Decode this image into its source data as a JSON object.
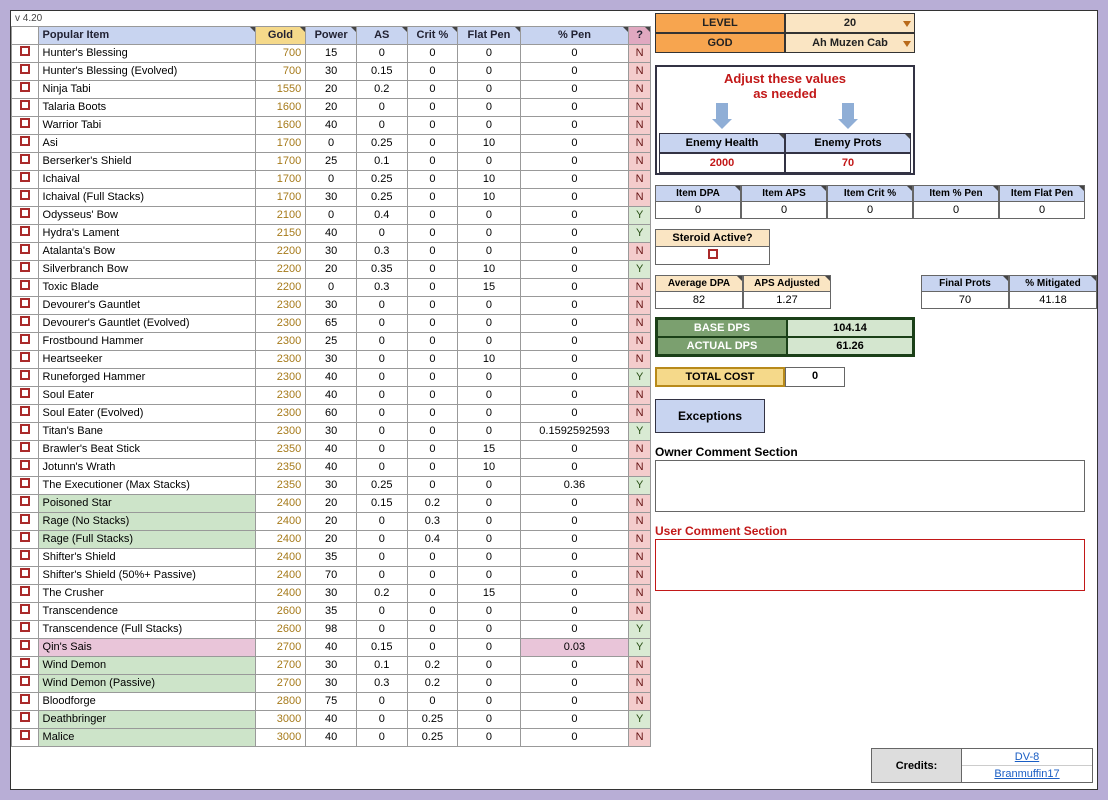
{
  "version": "v 4.20",
  "headers": {
    "checkbox": "",
    "item": "Popular Item",
    "gold": "Gold",
    "power": "Power",
    "as": "AS",
    "crit": "Crit %",
    "flatpen": "Flat Pen",
    "pctpen": "% Pen",
    "q": "?"
  },
  "items": [
    {
      "name": "Hunter's Blessing",
      "gold": 700,
      "pw": 15,
      "as": 0,
      "cr": 0,
      "fp": 0,
      "pp": "0",
      "yn": "N",
      "cls": ""
    },
    {
      "name": "Hunter's Blessing (Evolved)",
      "gold": 700,
      "pw": 30,
      "as": 0.15,
      "cr": 0,
      "fp": 0,
      "pp": "0",
      "yn": "N",
      "cls": ""
    },
    {
      "name": "Ninja Tabi",
      "gold": 1550,
      "pw": 20,
      "as": 0.2,
      "cr": 0,
      "fp": 0,
      "pp": "0",
      "yn": "N",
      "cls": ""
    },
    {
      "name": "Talaria Boots",
      "gold": 1600,
      "pw": 20,
      "as": 0,
      "cr": 0,
      "fp": 0,
      "pp": "0",
      "yn": "N",
      "cls": ""
    },
    {
      "name": "Warrior Tabi",
      "gold": 1600,
      "pw": 40,
      "as": 0,
      "cr": 0,
      "fp": 0,
      "pp": "0",
      "yn": "N",
      "cls": ""
    },
    {
      "name": "Asi",
      "gold": 1700,
      "pw": 0,
      "as": 0.25,
      "cr": 0,
      "fp": 10,
      "pp": "0",
      "yn": "N",
      "cls": ""
    },
    {
      "name": "Berserker's Shield",
      "gold": 1700,
      "pw": 25,
      "as": 0.1,
      "cr": 0,
      "fp": 0,
      "pp": "0",
      "yn": "N",
      "cls": ""
    },
    {
      "name": "Ichaival",
      "gold": 1700,
      "pw": 0,
      "as": 0.25,
      "cr": 0,
      "fp": 10,
      "pp": "0",
      "yn": "N",
      "cls": ""
    },
    {
      "name": "Ichaival (Full Stacks)",
      "gold": 1700,
      "pw": 30,
      "as": 0.25,
      "cr": 0,
      "fp": 10,
      "pp": "0",
      "yn": "N",
      "cls": ""
    },
    {
      "name": "Odysseus' Bow",
      "gold": 2100,
      "pw": 0,
      "as": 0.4,
      "cr": 0,
      "fp": 0,
      "pp": "0",
      "yn": "Y",
      "cls": ""
    },
    {
      "name": "Hydra's Lament",
      "gold": 2150,
      "pw": 40,
      "as": 0,
      "cr": 0,
      "fp": 0,
      "pp": "0",
      "yn": "Y",
      "cls": ""
    },
    {
      "name": "Atalanta's Bow",
      "gold": 2200,
      "pw": 30,
      "as": 0.3,
      "cr": 0,
      "fp": 0,
      "pp": "0",
      "yn": "N",
      "cls": ""
    },
    {
      "name": "Silverbranch Bow",
      "gold": 2200,
      "pw": 20,
      "as": 0.35,
      "cr": 0,
      "fp": 10,
      "pp": "0",
      "yn": "Y",
      "cls": ""
    },
    {
      "name": "Toxic Blade",
      "gold": 2200,
      "pw": 0,
      "as": 0.3,
      "cr": 0,
      "fp": 15,
      "pp": "0",
      "yn": "N",
      "cls": ""
    },
    {
      "name": "Devourer's Gauntlet",
      "gold": 2300,
      "pw": 30,
      "as": 0,
      "cr": 0,
      "fp": 0,
      "pp": "0",
      "yn": "N",
      "cls": ""
    },
    {
      "name": "Devourer's Gauntlet (Evolved)",
      "gold": 2300,
      "pw": 65,
      "as": 0,
      "cr": 0,
      "fp": 0,
      "pp": "0",
      "yn": "N",
      "cls": ""
    },
    {
      "name": "Frostbound Hammer",
      "gold": 2300,
      "pw": 25,
      "as": 0,
      "cr": 0,
      "fp": 0,
      "pp": "0",
      "yn": "N",
      "cls": ""
    },
    {
      "name": "Heartseeker",
      "gold": 2300,
      "pw": 30,
      "as": 0,
      "cr": 0,
      "fp": 10,
      "pp": "0",
      "yn": "N",
      "cls": ""
    },
    {
      "name": "Runeforged Hammer",
      "gold": 2300,
      "pw": 40,
      "as": 0,
      "cr": 0,
      "fp": 0,
      "pp": "0",
      "yn": "Y",
      "cls": ""
    },
    {
      "name": "Soul Eater",
      "gold": 2300,
      "pw": 40,
      "as": 0,
      "cr": 0,
      "fp": 0,
      "pp": "0",
      "yn": "N",
      "cls": ""
    },
    {
      "name": "Soul Eater (Evolved)",
      "gold": 2300,
      "pw": 60,
      "as": 0,
      "cr": 0,
      "fp": 0,
      "pp": "0",
      "yn": "N",
      "cls": ""
    },
    {
      "name": "Titan's Bane",
      "gold": 2300,
      "pw": 30,
      "as": 0,
      "cr": 0,
      "fp": 0,
      "pp": "0.1592592593",
      "yn": "Y",
      "cls": ""
    },
    {
      "name": "Brawler's Beat Stick",
      "gold": 2350,
      "pw": 40,
      "as": 0,
      "cr": 0,
      "fp": 15,
      "pp": "0",
      "yn": "N",
      "cls": ""
    },
    {
      "name": "Jotunn's Wrath",
      "gold": 2350,
      "pw": 40,
      "as": 0,
      "cr": 0,
      "fp": 10,
      "pp": "0",
      "yn": "N",
      "cls": ""
    },
    {
      "name": "The Executioner (Max Stacks)",
      "gold": 2350,
      "pw": 30,
      "as": 0.25,
      "cr": 0,
      "fp": 0,
      "pp": "0.36",
      "yn": "Y",
      "cls": ""
    },
    {
      "name": "Poisoned Star",
      "gold": 2400,
      "pw": 20,
      "as": 0.15,
      "cr": 0.2,
      "fp": 0,
      "pp": "0",
      "yn": "N",
      "cls": "row-green"
    },
    {
      "name": "Rage (No Stacks)",
      "gold": 2400,
      "pw": 20,
      "as": 0,
      "cr": 0.3,
      "fp": 0,
      "pp": "0",
      "yn": "N",
      "cls": "row-green"
    },
    {
      "name": "Rage (Full Stacks)",
      "gold": 2400,
      "pw": 20,
      "as": 0,
      "cr": 0.4,
      "fp": 0,
      "pp": "0",
      "yn": "N",
      "cls": "row-green"
    },
    {
      "name": "Shifter's Shield",
      "gold": 2400,
      "pw": 35,
      "as": 0,
      "cr": 0,
      "fp": 0,
      "pp": "0",
      "yn": "N",
      "cls": ""
    },
    {
      "name": "Shifter's Shield (50%+ Passive)",
      "gold": 2400,
      "pw": 70,
      "as": 0,
      "cr": 0,
      "fp": 0,
      "pp": "0",
      "yn": "N",
      "cls": ""
    },
    {
      "name": "The Crusher",
      "gold": 2400,
      "pw": 30,
      "as": 0.2,
      "cr": 0,
      "fp": 15,
      "pp": "0",
      "yn": "N",
      "cls": ""
    },
    {
      "name": "Transcendence",
      "gold": 2600,
      "pw": 35,
      "as": 0,
      "cr": 0,
      "fp": 0,
      "pp": "0",
      "yn": "N",
      "cls": ""
    },
    {
      "name": "Transcendence (Full Stacks)",
      "gold": 2600,
      "pw": 98,
      "as": 0,
      "cr": 0,
      "fp": 0,
      "pp": "0",
      "yn": "Y",
      "cls": ""
    },
    {
      "name": "Qin's Sais",
      "gold": 2700,
      "pw": 40,
      "as": 0.15,
      "cr": 0,
      "fp": 0,
      "pp": "0.03",
      "yn": "Y",
      "cls": "row-pink"
    },
    {
      "name": "Wind Demon",
      "gold": 2700,
      "pw": 30,
      "as": 0.1,
      "cr": 0.2,
      "fp": 0,
      "pp": "0",
      "yn": "N",
      "cls": "row-green"
    },
    {
      "name": "Wind Demon (Passive)",
      "gold": 2700,
      "pw": 30,
      "as": 0.3,
      "cr": 0.2,
      "fp": 0,
      "pp": "0",
      "yn": "N",
      "cls": "row-green"
    },
    {
      "name": "Bloodforge",
      "gold": 2800,
      "pw": 75,
      "as": 0,
      "cr": 0,
      "fp": 0,
      "pp": "0",
      "yn": "N",
      "cls": ""
    },
    {
      "name": "Deathbringer",
      "gold": 3000,
      "pw": 40,
      "as": 0,
      "cr": 0.25,
      "fp": 0,
      "pp": "0",
      "yn": "Y",
      "cls": "row-green"
    },
    {
      "name": "Malice",
      "gold": 3000,
      "pw": 40,
      "as": 0,
      "cr": 0.25,
      "fp": 0,
      "pp": "0",
      "yn": "N",
      "cls": "row-green"
    }
  ],
  "right": {
    "level_label": "LEVEL",
    "level_value": "20",
    "god_label": "GOD",
    "god_value": "Ah Muzen Cab",
    "adjust_line1": "Adjust these values",
    "adjust_line2": "as needed",
    "enemy_health_h": "Enemy Health",
    "enemy_prots_h": "Enemy Prots",
    "enemy_health_v": "2000",
    "enemy_prots_v": "70",
    "item_cols": [
      "Item DPA",
      "Item APS",
      "Item Crit %",
      "Item % Pen",
      "Item Flat Pen"
    ],
    "item_vals": [
      "0",
      "0",
      "0",
      "0",
      "0"
    ],
    "steroid_h": "Steroid Active?",
    "avg_dpa_h": "Average DPA",
    "aps_adj_h": "APS Adjusted",
    "avg_dpa_v": "82",
    "aps_adj_v": "1.27",
    "final_prots_h": "Final Prots",
    "pct_mit_h": "% Mitigated",
    "final_prots_v": "70",
    "pct_mit_v": "41.18",
    "base_dps_k": "BASE DPS",
    "base_dps_v": "104.14",
    "actual_dps_k": "ACTUAL DPS",
    "actual_dps_v": "61.26",
    "total_cost_k": "TOTAL COST",
    "total_cost_v": "0",
    "exceptions": "Exceptions",
    "owner_comment_label": "Owner Comment Section",
    "user_comment_label": "User Comment Section",
    "credits_label": "Credits:",
    "credit1": "DV-8",
    "credit2": "Branmuffin17"
  }
}
